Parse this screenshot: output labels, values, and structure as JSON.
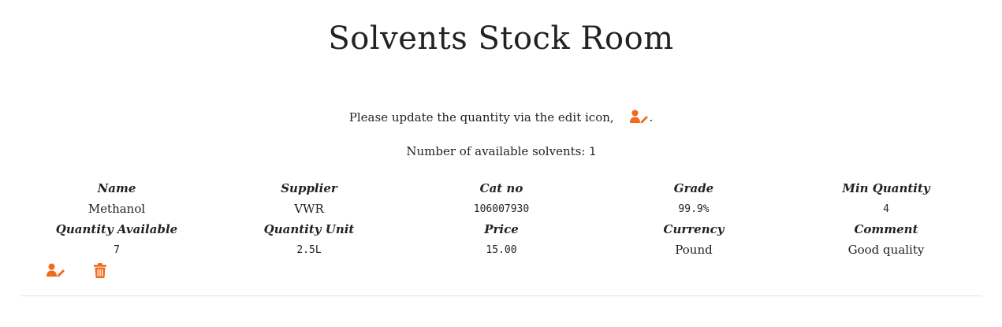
{
  "page": {
    "title": "Solvents Stock Room",
    "instruction_text": "Please update the quantity via the edit icon,",
    "instruction_suffix": ".",
    "count_label": "Number of available solvents:",
    "count_value": "1"
  },
  "table": {
    "headers_row1": [
      "Name",
      "Supplier",
      "Cat no",
      "Grade",
      "Min Quantity"
    ],
    "headers_row2": [
      "Quantity Available",
      "Quantity Unit",
      "Price",
      "Currency",
      "Comment"
    ],
    "rows": [
      {
        "name": "Methanol",
        "supplier": "VWR",
        "cat_no": "106007930",
        "grade": "99.9%",
        "min_quantity": "4",
        "quantity_available": "7",
        "quantity_unit": "2.5L",
        "price": "15.00",
        "currency": "Pound",
        "comment": "Good quality"
      }
    ]
  },
  "icons": {
    "edit": "user-edit-icon",
    "delete": "trash-icon"
  },
  "colors": {
    "accent": "#f26a1b",
    "text": "#222222",
    "divider": "#e3e3e3"
  }
}
